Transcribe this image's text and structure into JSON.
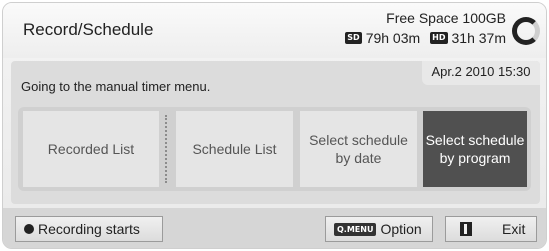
{
  "header": {
    "title": "Record/Schedule",
    "free_space": "Free Space 100GB",
    "sd_badge": "SD",
    "sd_time": "79h 03m",
    "hd_badge": "HD",
    "hd_time": "31h 37m"
  },
  "panel": {
    "message": "Going to the manual timer menu.",
    "datetime": "Apr.2 2010 15:30"
  },
  "menu": {
    "items": [
      {
        "label": "Recorded List"
      },
      {
        "label": "Schedule List"
      },
      {
        "label": "Select schedule by date"
      },
      {
        "label": "Select schedule by program",
        "selected": true
      }
    ]
  },
  "footer": {
    "recording_label": "Recording starts",
    "qmenu_badge": "Q.MENU",
    "option_label": "Option",
    "exit_label": "Exit"
  },
  "colors": {
    "selected_bg": "#505050",
    "item_bg": "#e5e5e5",
    "panel_bg": "#dcdcdc"
  }
}
